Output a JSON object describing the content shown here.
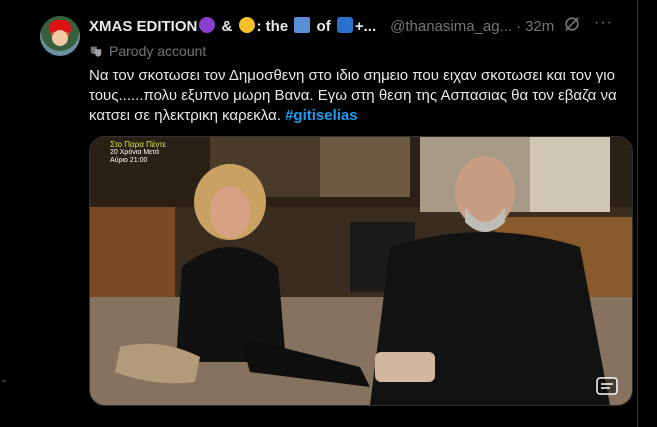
{
  "tweet": {
    "display_name_part1": "XMAS EDITION",
    "display_name_part2": " & ",
    "display_name_part3": ": the ",
    "display_name_part4": " of ",
    "display_name_part5": "+...",
    "handle": "@thanasima_ag...",
    "separator": "·",
    "time": "32m",
    "parody_label": "Parody account",
    "body_text": "Να τον σκοτωσει τον Δημοσθενη στο ιδιο σημειο που ειχαν σκοτωσει και τον γιο τους......πολυ εξυπνο μωρη Βανα. Εγω στη θεση της Ασπασιας θα τον εβαζα να κατσει σε ηλεκτρικη καρεκλα. ",
    "hashtag": "#gitiselias"
  },
  "media": {
    "overlay_line1": "Στο Παρα Πέντε",
    "overlay_line2": "20 Χρόνια Μετά",
    "overlay_line3": "Αύριο 21:00"
  },
  "icons": {
    "devil_emoji": "smiling-face-with-horns",
    "halo_emoji": "smiling-face-with-halo",
    "books_emoji": "books",
    "tv_emoji": "television",
    "grok": "grok-icon",
    "more": "more-icon",
    "mask": "theater-masks-icon",
    "captions": "captions-icon"
  },
  "colors": {
    "background": "#000000",
    "text": "#e7e9ea",
    "secondary": "#71767b",
    "link": "#1d9bf0",
    "border": "#2f3336"
  }
}
